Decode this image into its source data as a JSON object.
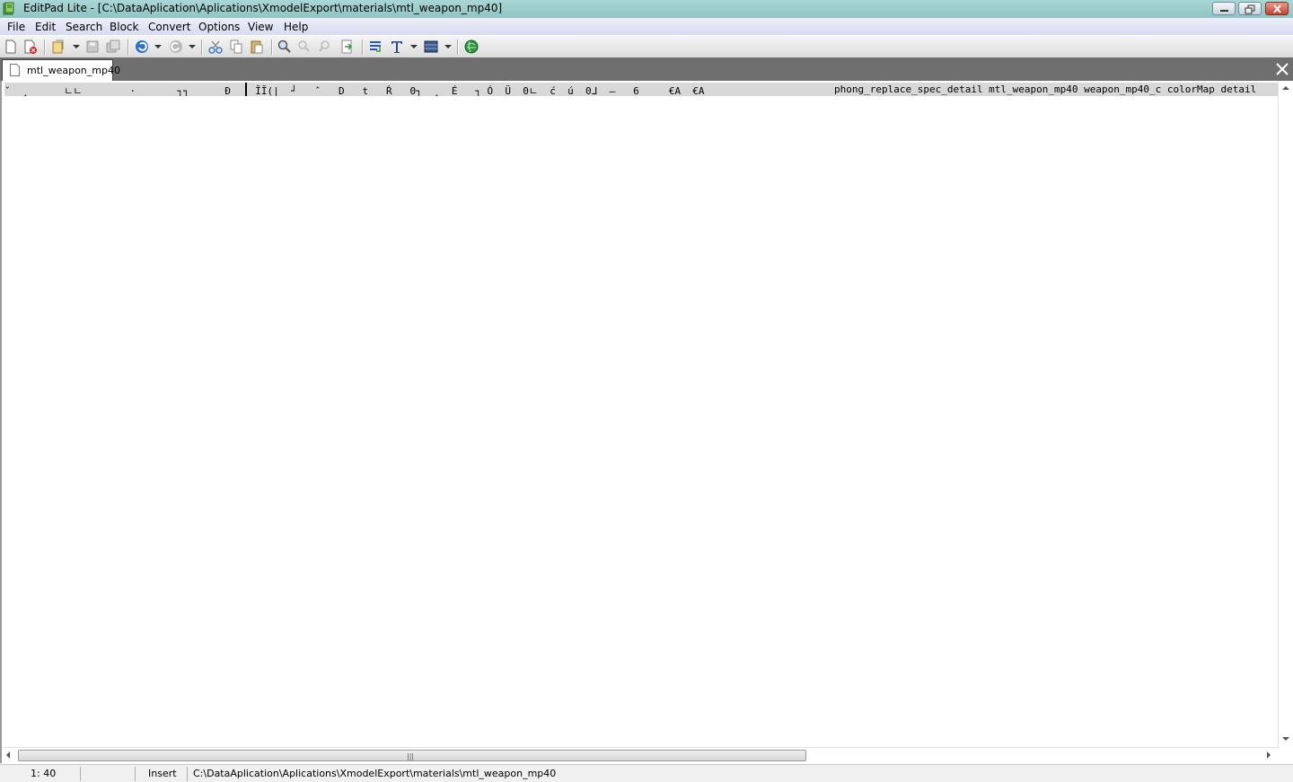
{
  "window": {
    "title": "EditPad Lite - [C:\\DataAplication\\Aplications\\XmodelExport\\materials\\mtl_weapon_mp40]"
  },
  "menu": [
    "File",
    "Edit",
    "Search",
    "Block",
    "Convert",
    "Options",
    "View",
    "Help"
  ],
  "toolbar": {
    "icons": [
      "new-file-icon",
      "close-file-icon",
      "open-file-icon",
      "save-icon",
      "save-all-icon",
      "undo-icon",
      "redo-icon",
      "cut-icon",
      "copy-icon",
      "paste-icon",
      "find-icon",
      "find-next-icon",
      "find-previous-icon",
      "replace-icon",
      "word-wrap-icon",
      "font-icon",
      "block-icon",
      "web-icon"
    ]
  },
  "tabs": [
    {
      "label": "mtl_weapon_mp40",
      "active": true
    }
  ],
  "editor": {
    "line1_head": "ˇ  ¸      ㄴㄴ        ·       ┐┐      Ð",
    "line1_mid": "  ĬĬ(|  ┘   ˆ   D   t   Ŕ   0┐  ¸  É   ┐ Ó  Ü  0ㄴ  ć  ú  0ᒧ  –   6     €A  €A",
    "line1_tail": "phong_replace_spec_detail mtl_weapon_mp40 weapon_mp40_c colorMap detail"
  },
  "status": {
    "position": "1: 40",
    "mode": "Insert",
    "path": "C:\\DataAplication\\Aplications\\XmodelExport\\materials\\mtl_weapon_mp40"
  },
  "colors": {
    "titlebar": "#8fc5c3",
    "menubar": "#d8dcf2",
    "tabstrip": "#6f6f6f",
    "current_line": "#d8d8d8"
  }
}
